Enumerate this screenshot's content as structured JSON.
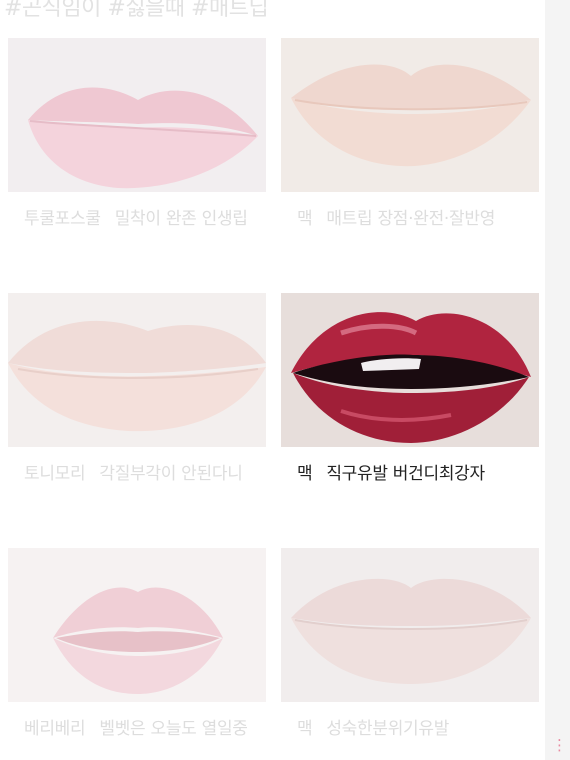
{
  "header": {
    "tags": "#곤식임이 #싫을때 #매트딥"
  },
  "cards": [
    {
      "brand": "투쿨포스쿨",
      "title": "밀착이 완존 인생립"
    },
    {
      "brand": "맥",
      "title": "매트립 장점·완전·잘반영"
    },
    {
      "brand": "토니모리",
      "title": "각질부각이 안된다니"
    },
    {
      "brand": "맥",
      "title": "직구유발 버건디최강자"
    },
    {
      "brand": "베리베리",
      "title": "벨벳은 오늘도 열일중"
    },
    {
      "brand": "맥",
      "title": "성숙한분위기유발"
    }
  ],
  "colors": {
    "active_text": "#222222",
    "faded_text": "#dddddd",
    "burgundy_lip": "#b0243f"
  },
  "icons": {
    "corner": "menu-dots-icon"
  }
}
